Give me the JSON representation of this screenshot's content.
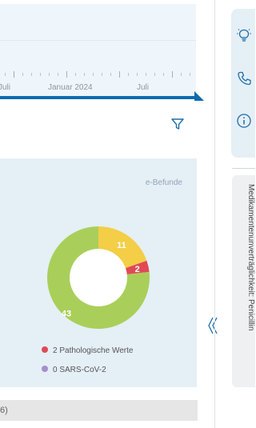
{
  "timeline": {
    "labels": [
      "Juli",
      "Januar 2024",
      "Juli"
    ]
  },
  "chart": {
    "source_label": "e-Befunde",
    "slices": [
      {
        "value": 43,
        "label": "43",
        "color": "#a9cf5a"
      },
      {
        "value": 11,
        "label": "11",
        "color": "#f3ce46"
      },
      {
        "value": 2,
        "label": "2",
        "color": "#e04a55"
      }
    ],
    "legend": [
      {
        "text": "2 Pathologische Werte",
        "color": "#e04a55"
      },
      {
        "text": "0 SARS-CoV-2",
        "color": "#a58fcc"
      }
    ]
  },
  "chart_data": {
    "type": "pie",
    "categories": [
      "43",
      "11",
      "2"
    ],
    "values": [
      43,
      11,
      2
    ]
  },
  "footer": {
    "text": "6)"
  },
  "sidebar": {
    "icons": [
      "lightbulb-icon",
      "phone-icon",
      "info-icon"
    ],
    "vertical_tab": "Medikamentenunverträglichkeit: Penicillin"
  }
}
